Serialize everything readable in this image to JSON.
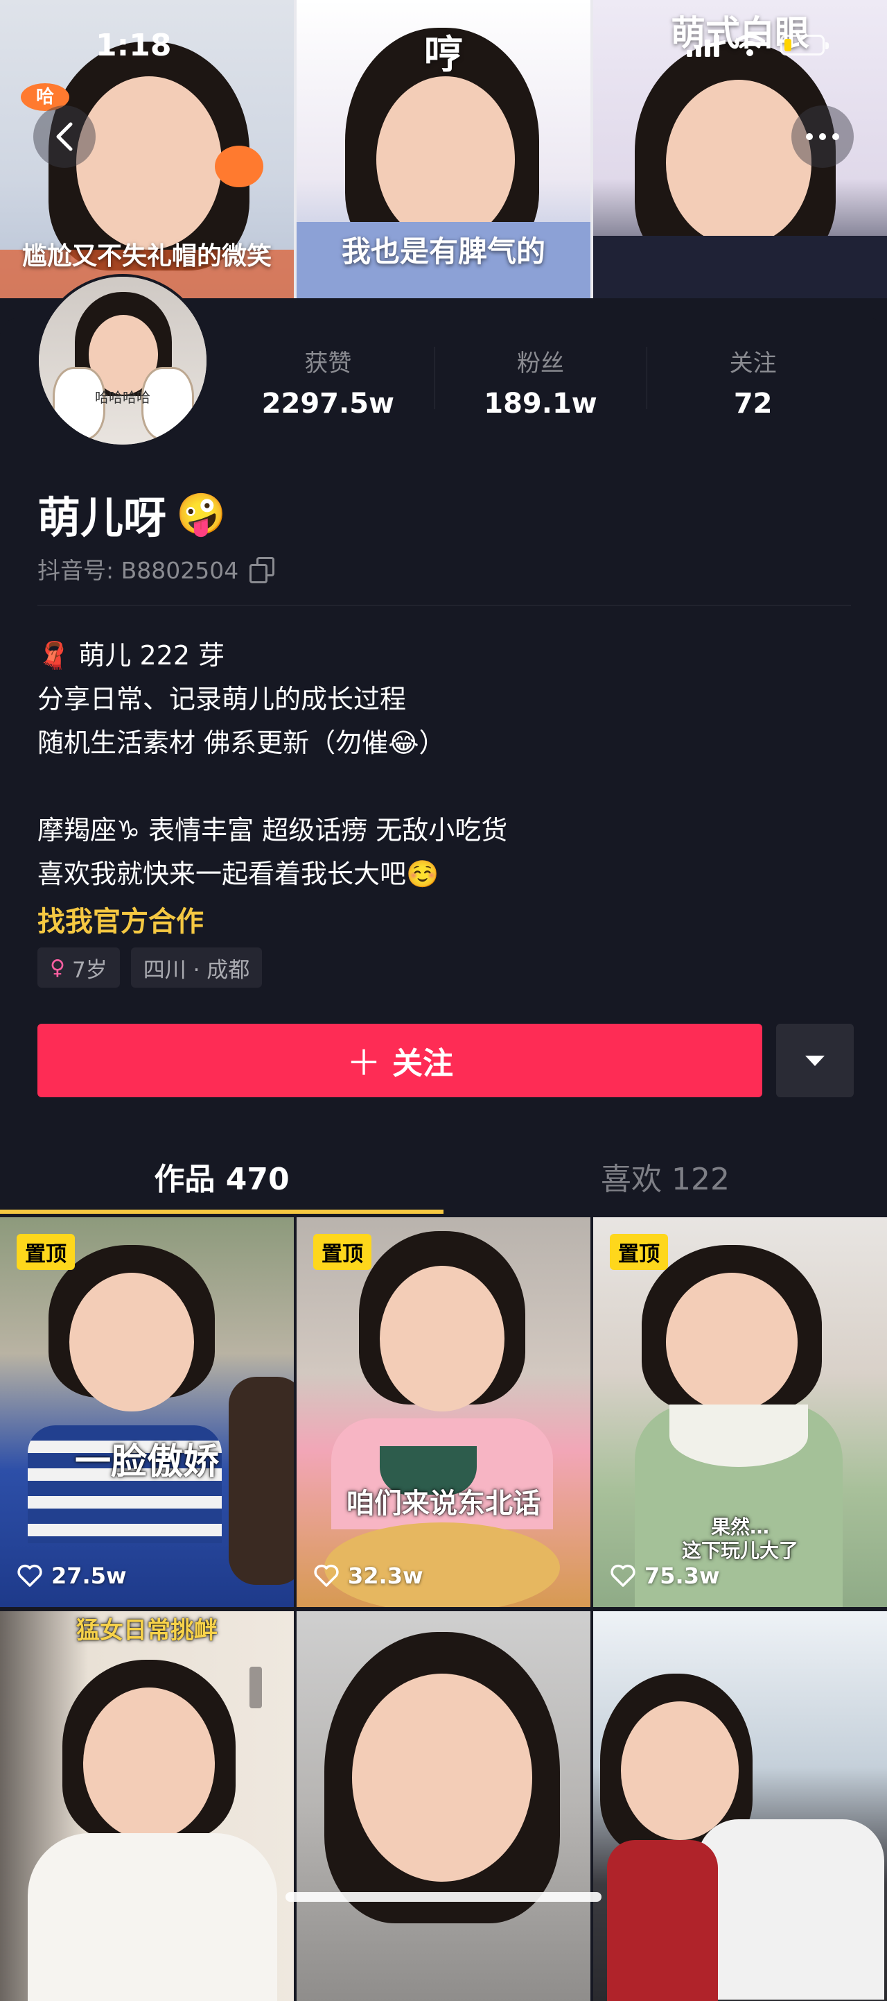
{
  "status_bar": {
    "time": "1:18",
    "battery_percent": 20
  },
  "banner": {
    "tiles": [
      {
        "caption": "尴尬又不失礼帽的微笑",
        "top_caption": "",
        "side_label": "哈"
      },
      {
        "caption": "我也是有脾气的",
        "top_caption": "哼"
      },
      {
        "caption": "",
        "top_caption": "萌式白眼"
      }
    ]
  },
  "profile": {
    "name": "萌儿呀",
    "name_emoji": "🤪",
    "handle": "抖音号: B8802504",
    "avatar_caption": "哈哈哈哈",
    "stats": [
      {
        "label": "获赞",
        "value": "2297.5w"
      },
      {
        "label": "粉丝",
        "value": "189.1w"
      },
      {
        "label": "关注",
        "value": "72"
      }
    ],
    "bio": [
      "🧣 萌儿 222 芽",
      "分享日常、记录萌儿的成长过程",
      "随机生活素材 佛系更新（勿催😂）",
      "",
      "摩羯座♑ 表情丰富 超级话痨 无敌小吃货",
      "喜欢我就快来一起看着我长大吧☺️"
    ],
    "cooperate_link": "找我官方合作",
    "tags": {
      "age": "7岁",
      "location": "四川 · 成都"
    }
  },
  "actions": {
    "follow_label": "关注",
    "follow_icon": "plus-icon",
    "more_icon": "caret-down-icon"
  },
  "tabs": [
    {
      "label": "作品 470",
      "active": true
    },
    {
      "label": "喜欢 122",
      "active": false
    }
  ],
  "videos": [
    {
      "pinned": true,
      "pin_label": "置顶",
      "likes": "27.5w",
      "caption": "一脸傲娇"
    },
    {
      "pinned": true,
      "pin_label": "置顶",
      "likes": "32.3w",
      "caption": "咱们来说东北话"
    },
    {
      "pinned": true,
      "pin_label": "置顶",
      "likes": "75.3w",
      "caption": "果然…\n这下玩儿大了"
    },
    {
      "pinned": false,
      "likes": "",
      "caption": "猛女日常挑衅"
    },
    {
      "pinned": false,
      "likes": "",
      "caption": ""
    },
    {
      "pinned": false,
      "likes": "",
      "caption": ""
    }
  ],
  "colors": {
    "background": "#161823",
    "accent_red": "#fe2c55",
    "accent_yellow": "#f5c842"
  }
}
